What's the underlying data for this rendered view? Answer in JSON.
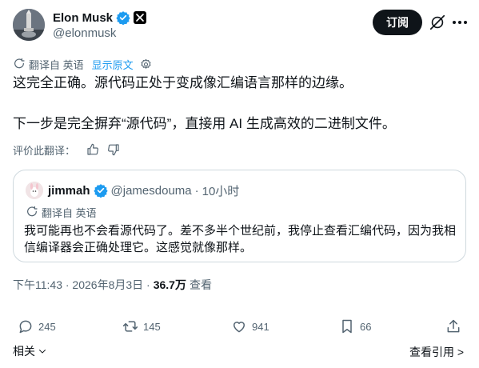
{
  "author": {
    "name": "Elon Musk",
    "handle": "@elonmusk",
    "verified": true,
    "affiliate_badge": "x-logo-badge"
  },
  "header": {
    "subscribe_label": "订阅",
    "grok_icon": "grok-icon",
    "more_icon": "more-icon"
  },
  "translation": {
    "translated_from": "翻译自 英语",
    "show_original": "显示原文"
  },
  "post": {
    "lines": [
      "这完全正确。源代码正处于变成像汇编语言那样的边缘。",
      "下一步是完全摒弃“源代码”，直接用 AI 生成高效的二进制文件。"
    ]
  },
  "rate_translation": {
    "label": "评价此翻译："
  },
  "quote": {
    "name": "jimmah",
    "handle": "@jamesdouma",
    "separator": "·",
    "time": "10小时",
    "translated_from": "翻译自 英语",
    "lines": [
      "我可能再也不会看源代码了。差不多半个世纪前，我停止查看汇编代码，因为我相",
      "信编译器会正确处理它。这感觉就像那样。"
    ]
  },
  "meta": {
    "timestamp": "下午11:43 · 2026年8月3日 · ",
    "views": "36.7万",
    "views_label": "查看"
  },
  "actions": {
    "replies": "245",
    "reposts": "145",
    "likes": "941",
    "bookmarks": "66"
  },
  "footer": {
    "related": "相关",
    "view_quotes": "查看引用 >"
  },
  "colors": {
    "accent": "#1d9bf0",
    "text": "#0f1419",
    "muted": "#536471",
    "border": "#cfd9de"
  }
}
